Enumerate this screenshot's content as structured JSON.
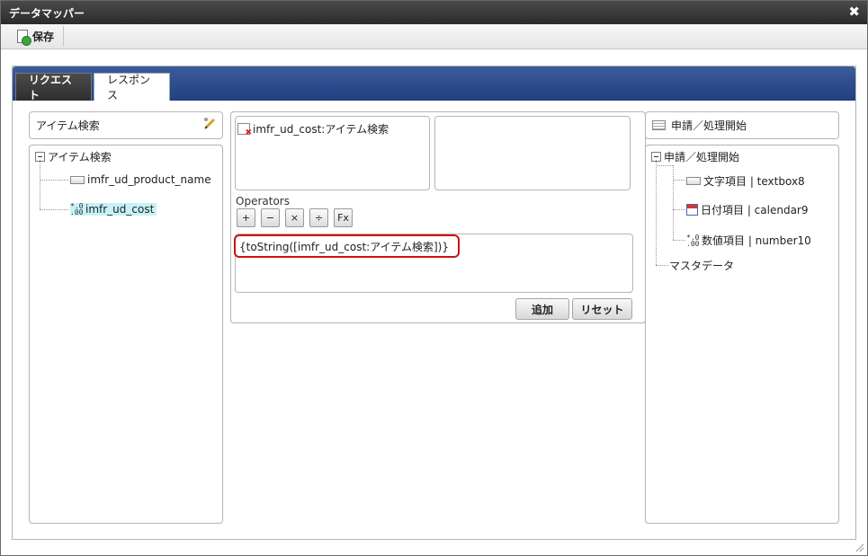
{
  "window": {
    "title": "データマッパー"
  },
  "toolbar": {
    "save_label": "保存"
  },
  "tabs": [
    {
      "label": "リクエスト"
    },
    {
      "label": "レスポンス"
    }
  ],
  "left": {
    "header": "アイテム検索",
    "tree_root": "アイテム検索",
    "items": [
      {
        "label": "imfr_ud_product_name"
      },
      {
        "label": "imfr_ud_cost"
      }
    ]
  },
  "middle": {
    "source_field": "imfr_ud_cost:アイテム検索",
    "operators_label": "Operators",
    "operators": [
      "+",
      "−",
      "×",
      "÷",
      "Fx"
    ],
    "expression": "{toString([imfr_ud_cost:アイテム検索])}",
    "add_label": "追加",
    "reset_label": "リセット"
  },
  "right": {
    "header": "申請／処理開始",
    "tree_root": "申請／処理開始",
    "items": [
      {
        "label": "文字項目 | textbox8"
      },
      {
        "label": "日付項目 | calendar9"
      },
      {
        "label": "数値項目 | number10"
      }
    ],
    "extra": "マスタデータ"
  },
  "colors": {
    "accent": "#223f80",
    "highlight": "#cc1111",
    "selection": "#c5f2f7"
  }
}
